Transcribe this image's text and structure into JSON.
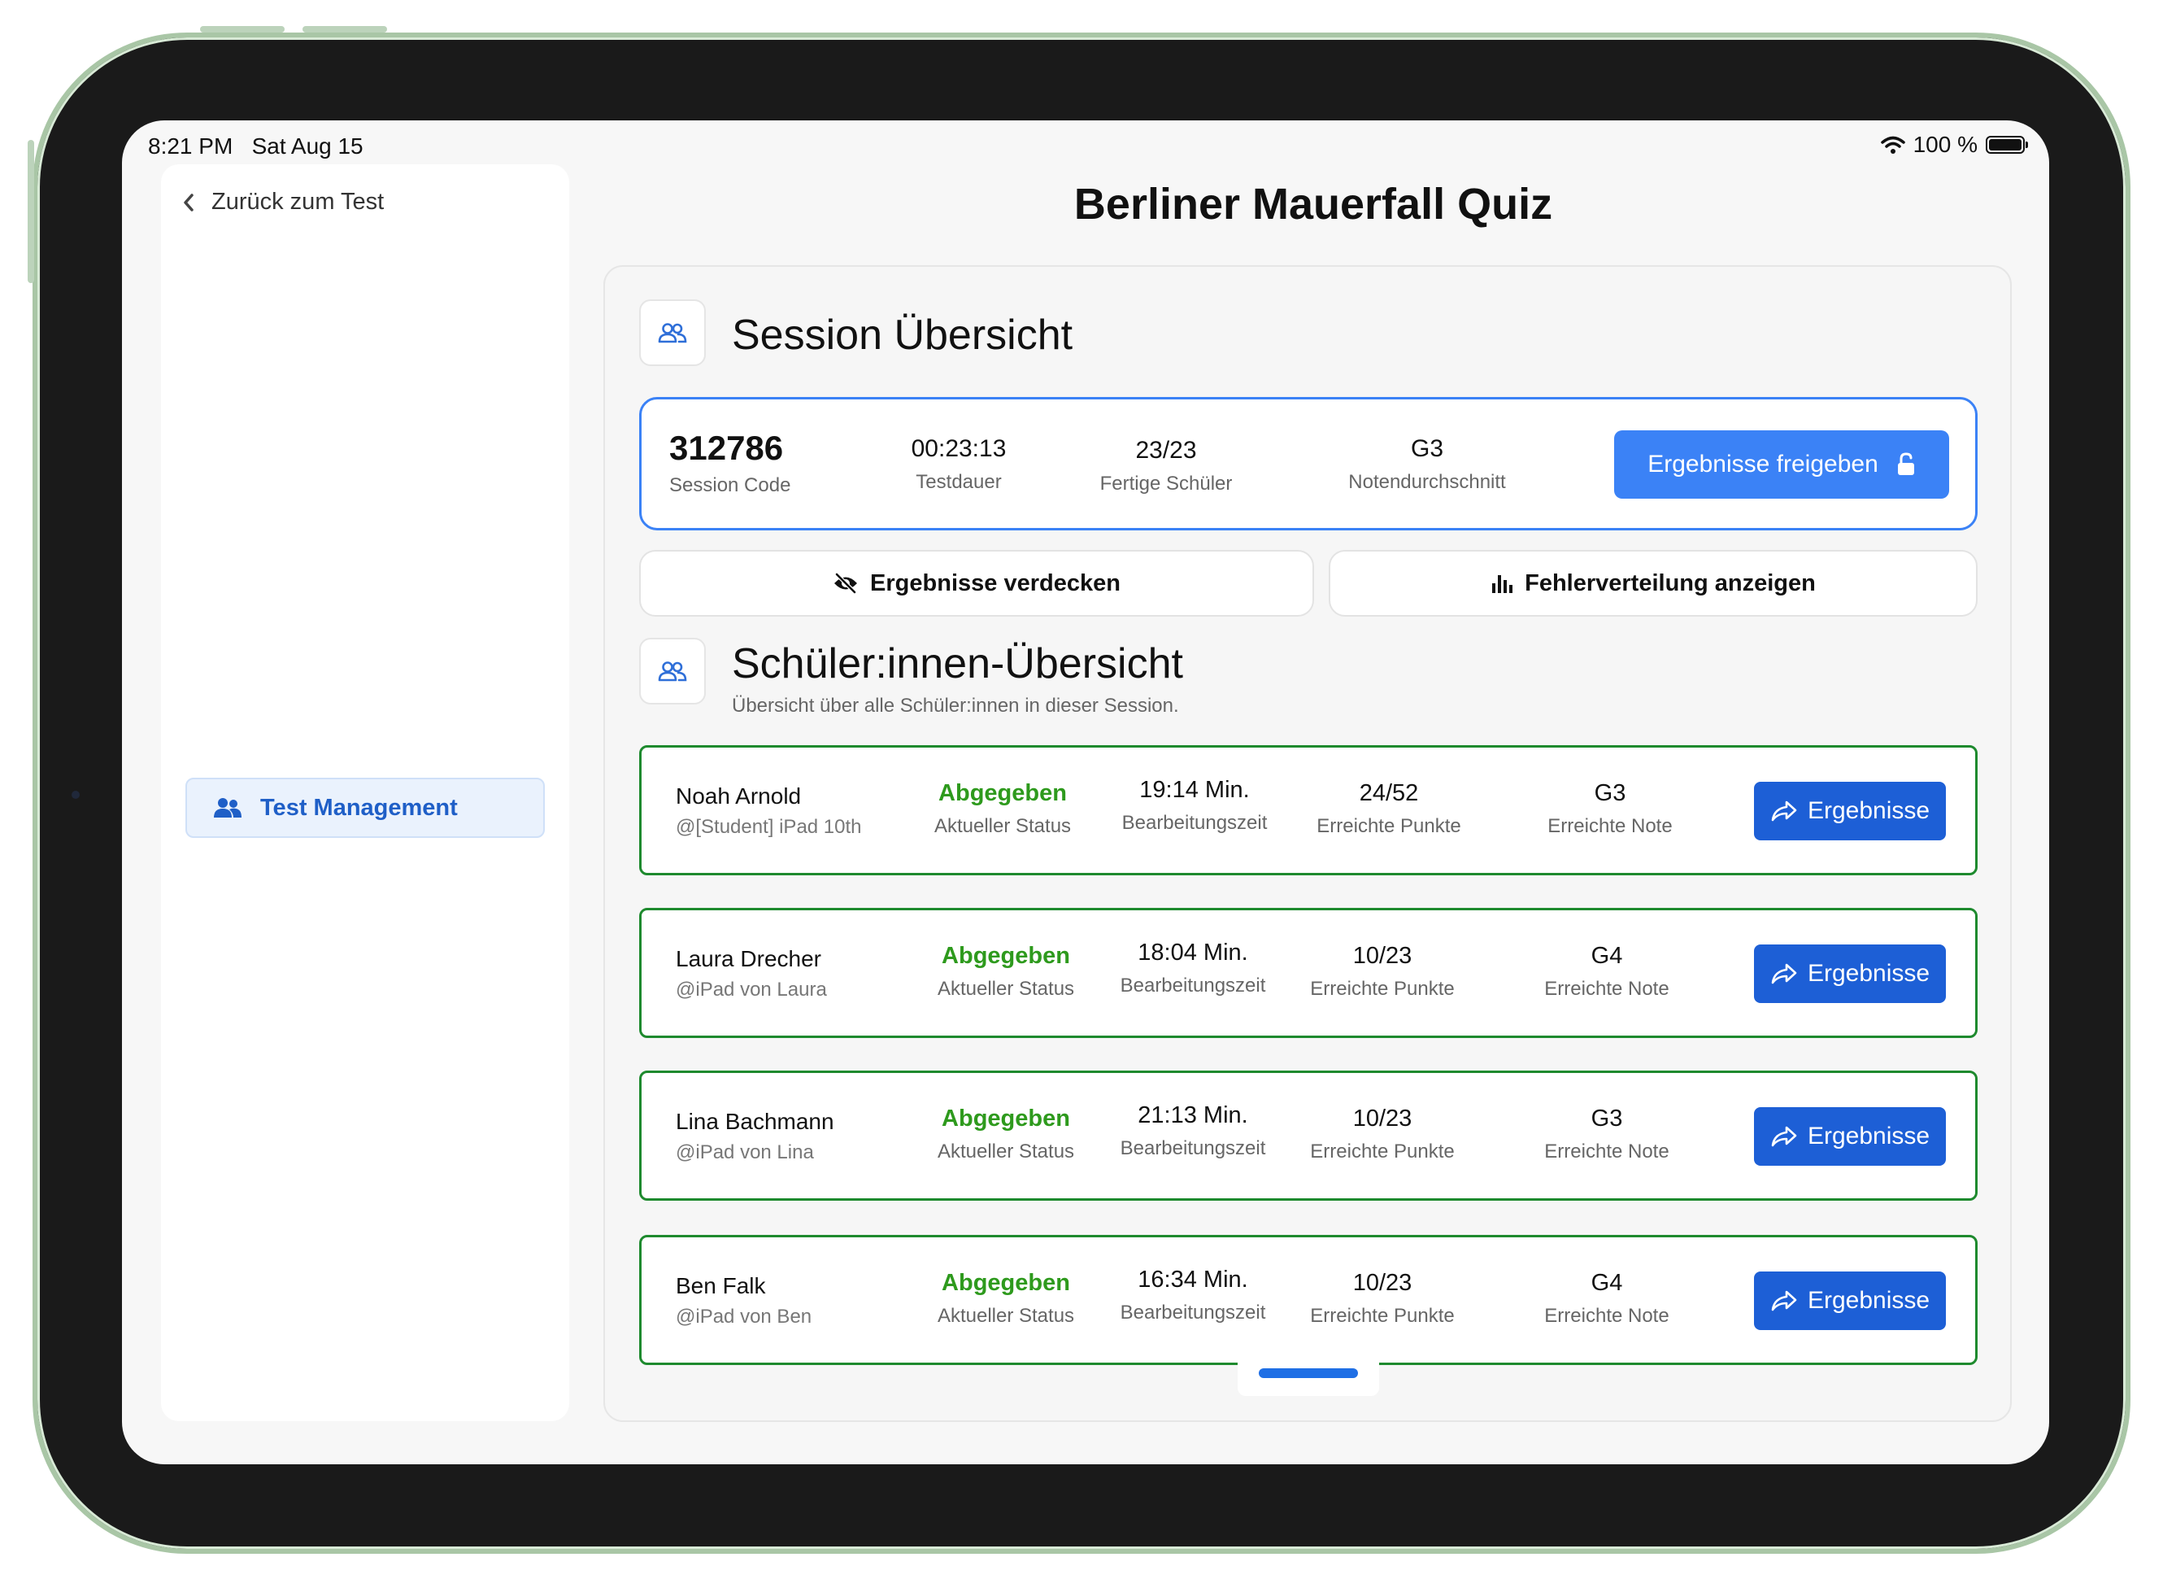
{
  "status_bar": {
    "time": "8:21 PM",
    "date": "Sat Aug 15",
    "battery": "100 %"
  },
  "sidebar": {
    "back_label": "Zurück zum Test",
    "nav_items": [
      {
        "label": "Test Management",
        "icon": "users-icon",
        "active": true
      }
    ]
  },
  "page": {
    "title": "Berliner Mauerfall Quiz"
  },
  "session": {
    "title": "Session Übersicht",
    "code": "312786",
    "code_label": "Session Code",
    "duration": "00:23:13",
    "duration_label": "Testdauer",
    "finished": "23/23",
    "finished_label": "Fertige Schüler",
    "grade_avg": "G3",
    "grade_avg_label": "Notendurchschnitt",
    "release_button": "Ergebnisse freigeben"
  },
  "actions": {
    "hide_results": "Ergebnisse verdecken",
    "show_errors": "Fehlerverteilung anzeigen"
  },
  "students_section": {
    "title": "Schüler:innen-Übersicht",
    "subtitle": "Übersicht über alle Schüler:innen in dieser Session.",
    "status_label": "Aktueller Status",
    "time_label": "Bearbeitungszeit",
    "points_label": "Erreichte Punkte",
    "grade_label": "Erreichte Note",
    "results_button": "Ergebnisse"
  },
  "students": [
    {
      "name": "Noah Arnold",
      "device": "@[Student] iPad 10th",
      "status": "Abgegeben",
      "time": "19:14 Min.",
      "points": "24/52",
      "grade": "G3"
    },
    {
      "name": "Laura Drecher",
      "device": "@iPad von Laura",
      "status": "Abgegeben",
      "time": "18:04 Min.",
      "points": "10/23",
      "grade": "G4"
    },
    {
      "name": "Lina Bachmann",
      "device": "@iPad von Lina",
      "status": "Abgegeben",
      "time": "21:13 Min.",
      "points": "10/23",
      "grade": "G3"
    },
    {
      "name": "Ben Falk",
      "device": "@iPad von Ben",
      "status": "Abgegeben",
      "time": "16:34 Min.",
      "points": "10/23",
      "grade": "G4"
    }
  ],
  "colors": {
    "accent": "#3b82f6",
    "button_dark": "#1d5fd6",
    "success": "#2e9a1d",
    "row_border": "#1e8a2e"
  }
}
